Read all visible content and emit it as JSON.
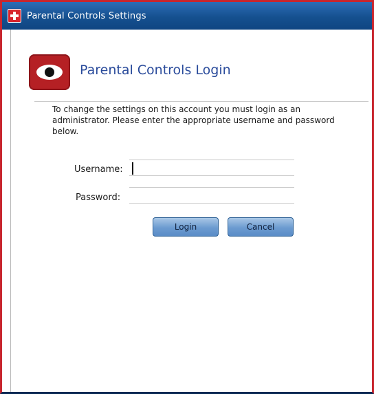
{
  "window": {
    "title": "Parental Controls Settings"
  },
  "header": {
    "title": "Parental Controls Login"
  },
  "instructions": "To change the settings on this account you must login as an administrator. Please enter the appropriate username and password below.",
  "form": {
    "username_label": "Username:",
    "username_value": "",
    "password_label": "Password:",
    "password_value": ""
  },
  "buttons": {
    "login_label": "Login",
    "cancel_label": "Cancel"
  },
  "icons": {
    "title_icon": "red-cross-icon",
    "logo_icon": "eye-icon"
  },
  "colors": {
    "titlebar": "#15508f",
    "header_title": "#2a4b9b",
    "logo_bg": "#b52024",
    "window_border": "#c8262e"
  }
}
